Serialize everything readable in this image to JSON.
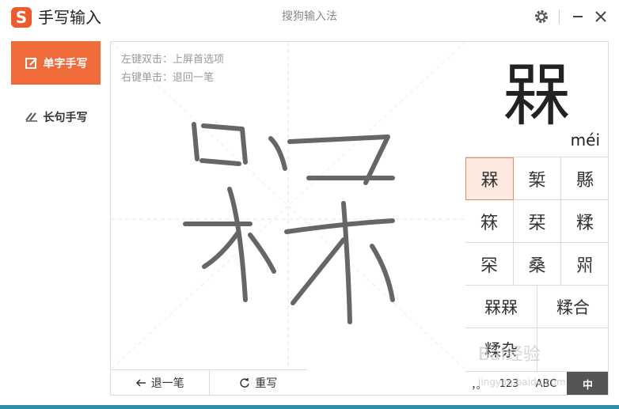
{
  "window": {
    "app_title": "手写输入",
    "center_title": "搜狗输入法",
    "logo_letter": "S"
  },
  "sidebar": {
    "items": [
      {
        "label": "单字手写",
        "active": true
      },
      {
        "label": "长句手写",
        "active": false
      }
    ]
  },
  "canvas": {
    "hint_line1": "左键双击：上屏首选项",
    "hint_line2": "右键单击：退回一笔",
    "undo_label": "退一笔",
    "rewrite_label": "重写"
  },
  "preview": {
    "char": "槑",
    "pinyin": "méi"
  },
  "candidates": {
    "row1": [
      "槑",
      "椠",
      "縣"
    ],
    "row2": [
      "箖",
      "栞",
      "糅"
    ],
    "row3": [
      "罙",
      "桑",
      "喌"
    ],
    "row4": [
      "槑槑",
      "糅合"
    ],
    "row5": [
      "糅杂"
    ]
  },
  "bottom_bar": {
    "punct": "，。",
    "num": "123",
    "abc": "ABC",
    "zh": "中"
  },
  "watermark": {
    "main": "Bai经验",
    "sub": "jingyan.baidu.com"
  },
  "colors": {
    "accent": "#ef6c3a",
    "selected_bg": "#fde9df",
    "mode_active_text": "#ffffff",
    "zh_bg": "#555555"
  }
}
